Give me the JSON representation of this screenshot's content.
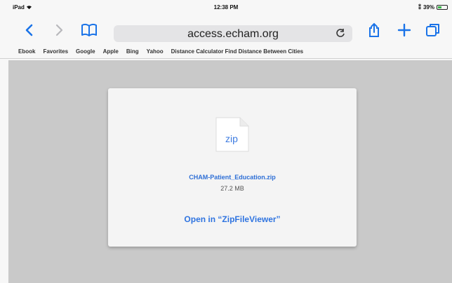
{
  "status": {
    "device": "iPad",
    "time": "12:38 PM",
    "battery_text": "39%",
    "battery_level": 0.39
  },
  "toolbar": {
    "url": "access.echam.org",
    "accent_color": "#1a73e8"
  },
  "bookmarks": [
    "Ebook",
    "Favorites",
    "Google",
    "Apple",
    "Bing",
    "Yahoo",
    "Distance Calculator Find Distance Between Cities"
  ],
  "download": {
    "icon_label": "zip",
    "file_name": "CHAM-Patient_Education.zip",
    "file_size": "27.2 MB",
    "open_label": "Open in “ZipFileViewer”"
  }
}
